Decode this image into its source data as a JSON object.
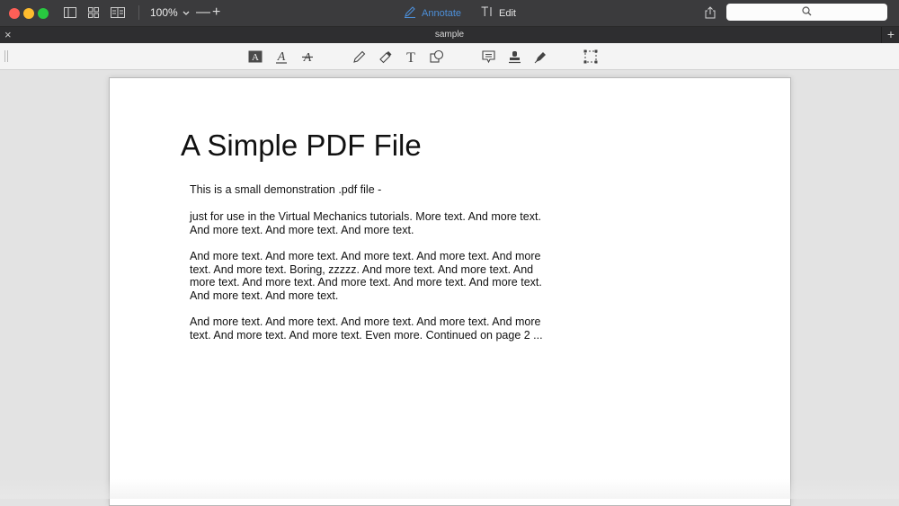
{
  "window": {
    "zoom_label": "100%",
    "zoom_out_label": "—",
    "zoom_in_label": "+",
    "mode_annotate_label": "Annotate",
    "mode_edit_label": "Edit"
  },
  "tab": {
    "title": "sample",
    "close_label": "×",
    "add_label": "+"
  },
  "colors": {
    "accent": "#4d8fd8",
    "titlebar": "#3b3b3d",
    "close": "#fe5f57",
    "minimize": "#febc2e",
    "zoom": "#28c840"
  },
  "annotation_tools": [
    "text-highlight-icon",
    "text-underline-icon",
    "text-strikethrough-icon",
    "pencil-icon",
    "eraser-icon",
    "text-box-icon",
    "shapes-icon",
    "note-icon",
    "stamp-icon",
    "signature-pen-icon",
    "selection-icon"
  ],
  "document": {
    "title": "A Simple PDF File",
    "paragraphs": [
      "This is a small demonstration .pdf file -",
      "just for use in the Virtual Mechanics tutorials. More text. And more text. And more text. And more text. And more text.",
      "And more text. And more text. And more text. And more text. And more text. And more text. Boring, zzzzz. And more text. And more text. And more text. And more text. And more text. And more text. And more text. And more text. And more text.",
      "And more text. And more text. And more text. And more text. And more text. And more text. And more text. Even more. Continued on page 2 ..."
    ]
  }
}
